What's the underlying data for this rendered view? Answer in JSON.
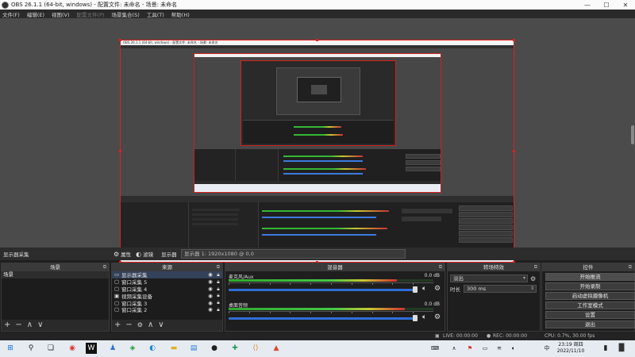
{
  "window": {
    "title": "OBS 26.1.1 (64-bit, windows) - 配置文件: 未命名 - 场景: 未命名",
    "minimize": "—",
    "maximize": "☐",
    "close": "✕"
  },
  "menu": {
    "items": [
      "文件(F)",
      "编辑(E)",
      "视图(V)",
      "配置文件(P)",
      "场景集合(S)",
      "工具(T)",
      "帮助(H)"
    ],
    "disabled_index": 3
  },
  "preview": {
    "nested_title": "OBS 26.1.1 (64-bit, windows) - 配置文件: 未命名 - 场景: 未命名"
  },
  "header": {
    "source_label": "显示器采集",
    "properties_label": "属性",
    "filters_label": "滤镜",
    "display_label": "显示器",
    "display_value": "显示器 1: 1920x1080 @ 0,0"
  },
  "scenes": {
    "title": "场景",
    "items": [
      "场景"
    ]
  },
  "sources": {
    "title": "来源",
    "items": [
      {
        "name": "显示器采集",
        "icon": "monitor-icon"
      },
      {
        "name": "窗口采集 5",
        "icon": "window-icon"
      },
      {
        "name": "窗口采集 4",
        "icon": "window-icon"
      },
      {
        "name": "视频采集设备",
        "icon": "camera-icon"
      },
      {
        "name": "窗口采集 3",
        "icon": "window-icon"
      },
      {
        "name": "窗口采集 2",
        "icon": "window-icon"
      }
    ]
  },
  "mixer": {
    "title": "混音器",
    "channels": [
      {
        "name": "麦克风/Aux",
        "db": "0.0 dB",
        "level": 0.82
      },
      {
        "name": "桌面音频",
        "db": "0.0 dB",
        "level": 0.86
      }
    ]
  },
  "transitions": {
    "title": "转场特效",
    "type": "淡出",
    "duration_label": "时长",
    "duration_value": "300 ms"
  },
  "controls": {
    "title": "控件",
    "buttons": [
      "开始推流",
      "开始录制",
      "启动虚拟摄像机",
      "工作室模式",
      "设置",
      "退出"
    ]
  },
  "status": {
    "live": "LIVE: 00:00:00",
    "rec": "REC: 00:00:00",
    "cpu": "CPU: 0.7%, 30.00 fps"
  },
  "taskbar": {
    "time": "23:19 周四",
    "date": "2022/11/10"
  },
  "colors": {
    "accent_red": "#e02020",
    "slider_blue": "#2f6ed8",
    "meter_green": "#46c846"
  }
}
